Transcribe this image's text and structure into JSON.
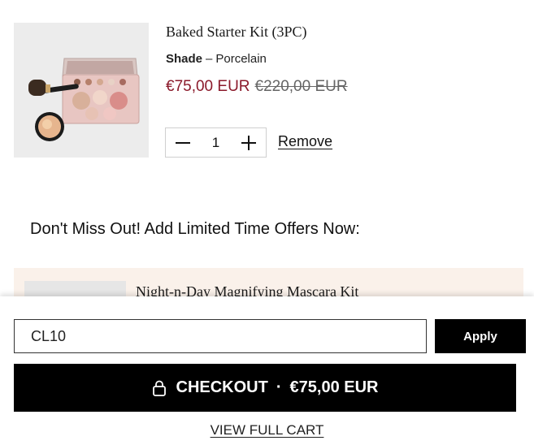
{
  "cart_item": {
    "title": "Baked Starter Kit (3PC)",
    "shade_label": "Shade",
    "shade_separator": "–",
    "shade_value": "Porcelain",
    "sale_price": "€75,00 EUR",
    "original_price": "€220,00 EUR",
    "quantity": "1",
    "remove_label": "Remove",
    "image_icon": "makeup-kit-product-image"
  },
  "offers": {
    "heading": "Don't Miss Out! Add Limited Time Offers Now:",
    "items": [
      {
        "title": "Night-n-Day Magnifying Mascara Kit"
      }
    ]
  },
  "promo": {
    "value": "CL10",
    "apply_label": "Apply"
  },
  "checkout": {
    "label": "CHECKOUT",
    "separator": "·",
    "total": "€75,00 EUR",
    "icon": "lock-icon"
  },
  "view_cart_label": "VIEW FULL CART",
  "colors": {
    "sale_price": "#8b1a2b",
    "offer_background": "#faf1ea",
    "button_background": "#000000"
  }
}
